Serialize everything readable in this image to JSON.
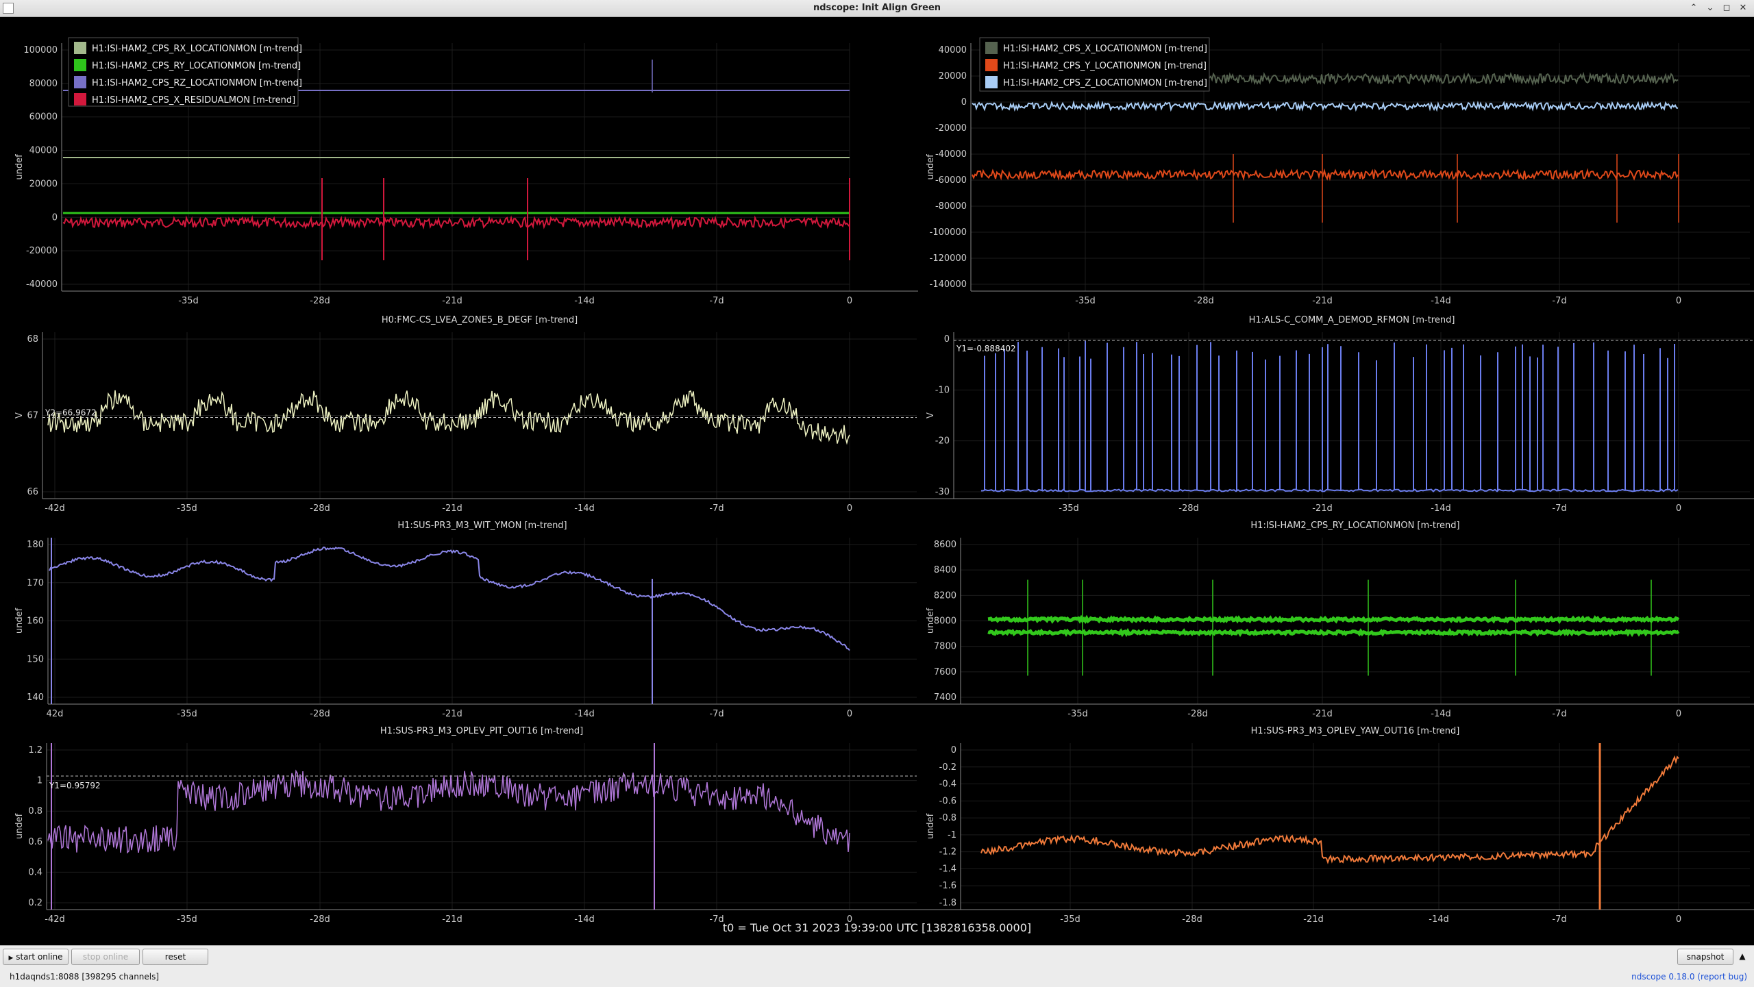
{
  "window": {
    "title": "ndscope: Init Align Green",
    "buttons": [
      "⌃",
      "⌄",
      "◻",
      "✕"
    ]
  },
  "t0_label": "t0 = Tue Oct 31 2023 19:39:00 UTC [1382816358.0000]",
  "controls": {
    "start_online": "start online",
    "stop_online": "stop online",
    "reset": "reset",
    "snapshot": "snapshot",
    "snapshot_arrow": "▲"
  },
  "status": {
    "server": "h1daqnds1:8088  [398295 channels]",
    "version": "ndscope 0.18.0",
    "report_bug": "(report bug)"
  },
  "colors": {
    "background": "#000000",
    "grid": "#1d1d1d",
    "axis": "#888888",
    "cursor": "#bbbbbb"
  },
  "plots": [
    {
      "id": "p1",
      "title": "",
      "ylabel": "undef",
      "yticks": [
        "100000",
        "80000",
        "60000",
        "40000",
        "20000",
        "0",
        "-20000",
        "-40000"
      ],
      "xticks": [
        "-35d",
        "-28d",
        "-21d",
        "-14d",
        "-7d",
        "0"
      ],
      "legend": [
        {
          "label": "H1:ISI-HAM2_CPS_RX_LOCATIONMON [m-trend]",
          "color": "#a3b98c"
        },
        {
          "label": "H1:ISI-HAM2_CPS_RY_LOCATIONMON [m-trend]",
          "color": "#2ec41b"
        },
        {
          "label": "H1:ISI-HAM2_CPS_RZ_LOCATIONMON [m-trend]",
          "color": "#7770c6"
        },
        {
          "label": "H1:ISI-HAM2_CPS_X_RESIDUALMON [m-trend]",
          "color": "#d2183c"
        }
      ]
    },
    {
      "id": "p2",
      "title": "",
      "ylabel": "undef",
      "yticks": [
        "40000",
        "20000",
        "0",
        "-20000",
        "-40000",
        "-60000",
        "-80000",
        "-100000",
        "-120000",
        "-140000"
      ],
      "xticks": [
        "-35d",
        "-28d",
        "-21d",
        "-14d",
        "-7d",
        "0"
      ],
      "legend": [
        {
          "label": "H1:ISI-HAM2_CPS_X_LOCATIONMON [m-trend]",
          "color": "#55624f"
        },
        {
          "label": "H1:ISI-HAM2_CPS_Y_LOCATIONMON [m-trend]",
          "color": "#e0491a"
        },
        {
          "label": "H1:ISI-HAM2_CPS_Z_LOCATIONMON [m-trend]",
          "color": "#a8ccf4"
        }
      ]
    },
    {
      "id": "p3",
      "title": "H0:FMC-CS_LVEA_ZONE5_B_DEGF [m-trend]",
      "ylabel": "V",
      "yticks": [
        "68",
        "67",
        "66"
      ],
      "xticks": [
        "-42d",
        "-35d",
        "-28d",
        "-21d",
        "-14d",
        "-7d",
        "0"
      ],
      "cursor": "Y2=66.9672",
      "color": "#eef2c2"
    },
    {
      "id": "p4",
      "title": "H1:ALS-C_COMM_A_DEMOD_RFMON [m-trend]",
      "ylabel": "V",
      "yticks": [
        "0",
        "-10",
        "-20",
        "-30"
      ],
      "xticks": [
        "-35d",
        "-28d",
        "-21d",
        "-14d",
        "-7d",
        "0"
      ],
      "cursor": "Y1=-0.888402",
      "color": "#6b7dee"
    },
    {
      "id": "p5",
      "title": "H1:SUS-PR3_M3_WIT_YMON [m-trend]",
      "ylabel": "undef",
      "yticks": [
        "180",
        "170",
        "160",
        "150",
        "140"
      ],
      "xticks": [
        "42d",
        "-35d",
        "-28d",
        "-21d",
        "-14d",
        "-7d",
        "0"
      ],
      "color": "#8a86e8"
    },
    {
      "id": "p6",
      "title": "H1:ISI-HAM2_CPS_RY_LOCATIONMON [m-trend]",
      "ylabel": "undef",
      "yticks": [
        "8600",
        "8400",
        "8200",
        "8000",
        "7800",
        "7600",
        "7400"
      ],
      "xticks": [
        "-35d",
        "-28d",
        "-21d",
        "-14d",
        "-7d",
        "0"
      ],
      "color": "#32c81c"
    },
    {
      "id": "p7",
      "title": "H1:SUS-PR3_M3_OPLEV_PIT_OUT16 [m-trend]",
      "ylabel": "undef",
      "yticks": [
        "1.2",
        "1",
        "0.8",
        "0.6",
        "0.4",
        "0.2"
      ],
      "xticks": [
        "-42d",
        "-35d",
        "-28d",
        "-21d",
        "-14d",
        "-7d",
        "0"
      ],
      "cursor": "Y1=0.95792",
      "color": "#b077d8"
    },
    {
      "id": "p8",
      "title": "H1:SUS-PR3_M3_OPLEV_YAW_OUT16 [m-trend]",
      "ylabel": "undef",
      "yticks": [
        "0",
        "-0.2",
        "-0.4",
        "-0.6",
        "-0.8",
        "-1",
        "-1.2",
        "-1.4",
        "-1.6",
        "-1.8"
      ],
      "xticks": [
        "-35d",
        "-28d",
        "-21d",
        "-14d",
        "-7d",
        "0"
      ],
      "color": "#f07a3a"
    }
  ]
}
